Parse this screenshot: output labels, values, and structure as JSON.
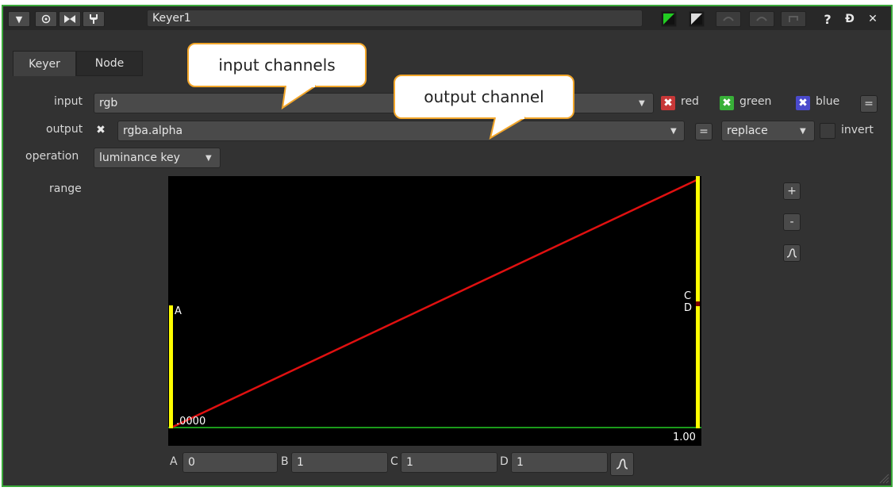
{
  "titlebar": {
    "node_name": "Keyer1",
    "help_label": "?",
    "float_label": "Ɖ",
    "close_label": "✕"
  },
  "tabs": [
    {
      "label": "Keyer"
    },
    {
      "label": "Node"
    }
  ],
  "callouts": {
    "input": "input channels",
    "output": "output channel"
  },
  "knobs": {
    "input_label": "input",
    "input_value": "rgb",
    "red_label": "red",
    "green_label": "green",
    "blue_label": "blue",
    "equals_label": "=",
    "output_label": "output",
    "output_value": "rgba.alpha",
    "op_equals_label": "=",
    "merge_value": "replace",
    "invert_label": "invert",
    "operation_label": "operation",
    "operation_value": "luminance key",
    "range_label": "range"
  },
  "curve": {
    "marker_a": "A",
    "marker_c": "C",
    "marker_d": "D",
    "x_start": ".0000",
    "x_end": "1.00",
    "plus_label": "+",
    "minus_label": "-"
  },
  "range_values": {
    "a_label": "A",
    "a_value": "0",
    "b_label": "B",
    "b_value": "1",
    "c_label": "C",
    "c_value": "1",
    "d_label": "D",
    "d_value": "1"
  },
  "colors": {
    "border": "#3aa83a",
    "curve": "#e01010",
    "handles": "#ffff00",
    "red_channel": "#c83838",
    "green_channel": "#38b038",
    "blue_channel": "#4a4acc"
  },
  "icons": [
    "collapse-icon",
    "target-icon",
    "bowtie-icon",
    "wrench-icon",
    "green-swatch-icon",
    "white-swatch-icon",
    "undo-icon",
    "redo-icon",
    "revert-icon",
    "help-icon",
    "float-icon",
    "close-icon",
    "smooth-curve-icon"
  ]
}
